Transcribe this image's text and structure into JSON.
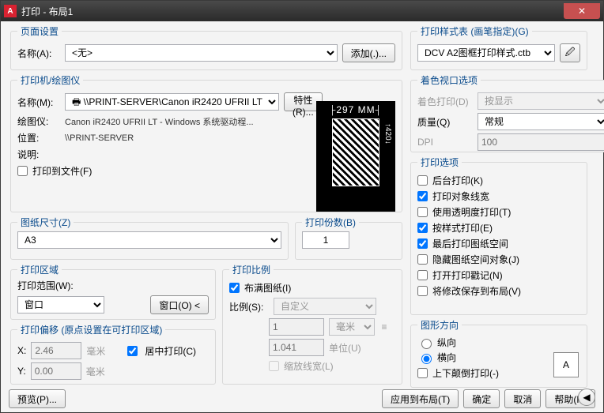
{
  "title": "打印 - 布局1",
  "page_setup": {
    "legend": "页面设置",
    "name_label": "名称(A):",
    "name_value": "<无>",
    "add_btn": "添加(.)..."
  },
  "printer": {
    "legend": "打印机/绘图仪",
    "name_label": "名称(M):",
    "name_value": "\\\\PRINT-SERVER\\Canon iR2420 UFRII LT",
    "props_btn": "特性(R)...",
    "plotter_label": "绘图仪:",
    "plotter_value": "Canon iR2420 UFRII LT - Windows 系统驱动程...",
    "location_label": "位置:",
    "location_value": "\\\\PRINT-SERVER",
    "desc_label": "说明:",
    "desc_value": "",
    "to_file": "打印到文件(F)",
    "preview_dim": "297 MM",
    "preview_h": "↑420↓"
  },
  "paper": {
    "legend": "图纸尺寸(Z)",
    "value": "A3"
  },
  "copies": {
    "legend": "打印份数(B)",
    "value": "1"
  },
  "area": {
    "legend": "打印区域",
    "scope_label": "打印范围(W):",
    "scope_value": "窗口",
    "window_btn": "窗口(O)"
  },
  "offset": {
    "legend": "打印偏移 (原点设置在可打印区域)",
    "x_label": "X:",
    "x_value": "2.46",
    "x_unit": "毫米",
    "y_label": "Y:",
    "y_value": "0.00",
    "y_unit": "毫米",
    "center": "居中打印(C)"
  },
  "scale": {
    "legend": "打印比例",
    "fit": "布满图纸(I)",
    "ratio_label": "比例(S):",
    "ratio_value": "自定义",
    "num": "1",
    "num_unit": "毫米",
    "den": "1.041",
    "den_unit": "单位(U)",
    "scale_lw": "缩放线宽(L)"
  },
  "style": {
    "legend": "打印样式表 (画笔指定)(G)",
    "value": "DCV A2图框打印样式.ctb"
  },
  "viewport": {
    "legend": "着色视口选项",
    "shade_label": "着色打印(D)",
    "shade_value": "按显示",
    "quality_label": "质量(Q)",
    "quality_value": "常规",
    "dpi_label": "DPI",
    "dpi_value": "100"
  },
  "options": {
    "legend": "打印选项",
    "o1": "后台打印(K)",
    "o2": "打印对象线宽",
    "o3": "使用透明度打印(T)",
    "o4": "按样式打印(E)",
    "o5": "最后打印图纸空间",
    "o6": "隐藏图纸空间对象(J)",
    "o7": "打开打印戳记(N)",
    "o8": "将修改保存到布局(V)",
    "c1": false,
    "c2": true,
    "c3": false,
    "c4": true,
    "c5": true,
    "c6": false,
    "c7": false,
    "c8": false
  },
  "orient": {
    "legend": "图形方向",
    "r1": "纵向",
    "r2": "横向",
    "upside": "上下颠倒打印(-)",
    "selected": "横向",
    "letter": "A"
  },
  "buttons": {
    "preview": "预览(P)...",
    "apply": "应用到布局(T)",
    "ok": "确定",
    "cancel": "取消",
    "help": "帮助(H)"
  }
}
